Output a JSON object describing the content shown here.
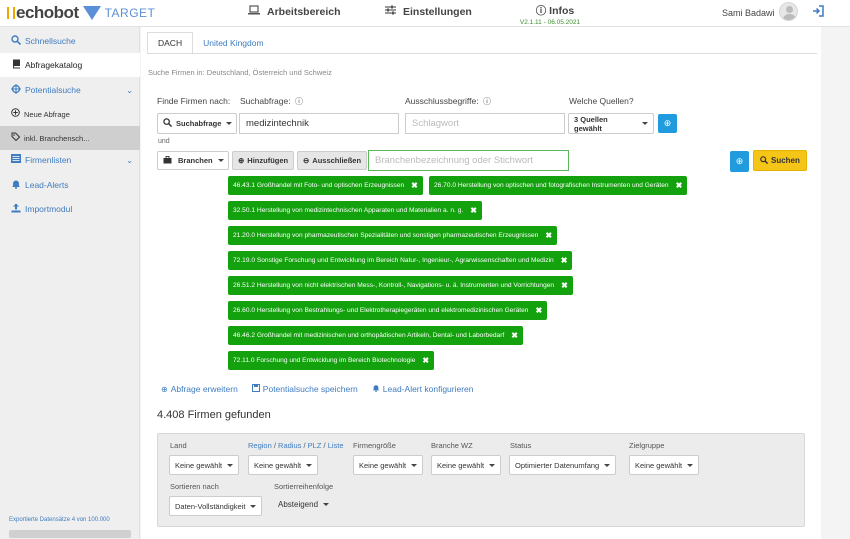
{
  "header": {
    "logo_text": "echobot",
    "logo_sub": "TARGET",
    "nav": {
      "workspace": "Arbeitsbereich",
      "settings": "Einstellungen",
      "infos": "Infos",
      "version": "V2.1.11 - 06.05.2021"
    },
    "user_name": "Sami Badawi"
  },
  "sidebar": {
    "items": [
      {
        "label": "Schnellsuche",
        "icon": "search-icon"
      },
      {
        "label": "Abfragekatalog",
        "icon": "book-icon"
      },
      {
        "label": "Potentialsuche",
        "icon": "crosshair-icon"
      },
      {
        "label": "Neue Abfrage",
        "icon": "plus-circle-icon"
      },
      {
        "label": "inkl. Branchensch...",
        "icon": "tag-icon"
      },
      {
        "label": "Firmenlisten",
        "icon": "list-icon"
      },
      {
        "label": "Lead-Alerts",
        "icon": "bell-icon"
      },
      {
        "label": "Importmodul",
        "icon": "upload-icon"
      }
    ],
    "export_text": "Exportierte Datensätze 4 von 100.000"
  },
  "main": {
    "tabs": [
      "DACH",
      "United Kingdom"
    ],
    "subtitle": "Suche Firmen in: Deutschland, Österreich und Schweiz",
    "labels": {
      "find": "Finde Firmen nach:",
      "query": "Suchabfrage:",
      "exclude": "Ausschlussbegriffe:",
      "sources": "Welche Quellen?"
    },
    "search_type": "Suchabfrage",
    "query_value": "medizintechnik",
    "exclude_placeholder": "Schlagwort",
    "sources_value": "3 Quellen gewählt",
    "and_label": "und",
    "branch_type": "Branchen",
    "add_label": "Hinzufügen",
    "exclude_label": "Ausschließen",
    "branch_placeholder": "Branchenbezeichnung oder Stichwort",
    "search_button": "Suchen",
    "tags": [
      "46.43.1 Großhandel mit Foto- und optischen Erzeugnissen",
      "26.70.0 Herstellung von optischen und fotografischen Instrumenten und Geräten",
      "32.50.1 Herstellung von medizintechnischen Apparaten und Materialien a. n. g.",
      "21.20.0 Herstellung von pharmazeutischen Spezialitäten und sonstigen pharmazeutischen Erzeugnissen",
      "72.19.0 Sonstige Forschung und Entwicklung im Bereich Natur-, Ingenieur-, Agrarwissenschaften und Medizin",
      "26.51.2 Herstellung von nicht elektrischen Mess-, Kontroll-, Navigations- u. ä. Instrumenten und Vorrichtungen",
      "26.60.0 Herstellung von Bestrahlungs- und Elektrotherapiegeräten und elektromedizinischen Geräten",
      "46.46.2 Großhandel mit medizinischen und orthopädischen Artikeln, Dental- und Laborbedarf",
      "72.11.0 Forschung und Entwicklung im Bereich Biotechnologie"
    ],
    "links": {
      "expand": "Abfrage erweitern",
      "save": "Potentialsuche speichern",
      "alert": "Lead-Alert konfigurieren"
    },
    "result_count": "4.408 Firmen gefunden",
    "filters": {
      "land": {
        "label": "Land",
        "value": "Keine gewählt"
      },
      "region": {
        "label_parts": [
          "Region",
          "Radius",
          "PLZ",
          "Liste"
        ],
        "value": "Keine gewählt"
      },
      "size": {
        "label": "Firmengröße",
        "value": "Keine gewählt"
      },
      "branche": {
        "label": "Branche WZ",
        "value": "Keine gewählt"
      },
      "status": {
        "label": "Status",
        "value": "Optimierter Datenumfang"
      },
      "target": {
        "label": "Zielgruppe",
        "value": "Keine gewählt"
      },
      "sort": {
        "label": "Sortieren nach",
        "value": "Daten-Vollständigkeit"
      },
      "order": {
        "label": "Sortierreihenfolge",
        "value": "Absteigend"
      }
    }
  }
}
